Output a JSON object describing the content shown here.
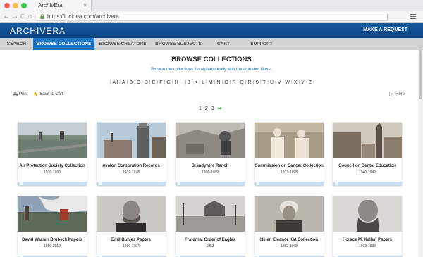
{
  "browser": {
    "tab_title": "ArchivEra",
    "tab_close": "×",
    "back": "←",
    "forward": "→",
    "reload": "C",
    "home": "⌂",
    "url": "https://lucidea.com/archivera",
    "traffic_colors": [
      "#fc605b",
      "#fdbc40",
      "#34c84a"
    ]
  },
  "header": {
    "logo": "ARCHIVERA",
    "request": "MAKE A REQUEST"
  },
  "nav": [
    {
      "label": "SEARCH",
      "active": false
    },
    {
      "label": "BROWSE COLLECTIONS",
      "active": true
    },
    {
      "label": "BROWSE CREATORS",
      "active": false
    },
    {
      "label": "BROWSE SUBJECTS",
      "active": false
    },
    {
      "label": "CART",
      "active": false
    },
    {
      "label": "SUPPORT",
      "active": false
    }
  ],
  "main": {
    "title": "BROWSE COLLECTIONS",
    "subtitle": "Browse the collections list alphabetically with the alphabet filters.",
    "alphabet": [
      "All",
      "A",
      "B",
      "C",
      "D",
      "E",
      "F",
      "G",
      "H",
      "I",
      "J",
      "K",
      "L",
      "M",
      "N",
      "O",
      "P",
      "Q",
      "R",
      "S",
      "T",
      "U",
      "V",
      "W",
      "X",
      "Y",
      "Z"
    ],
    "actions": {
      "print": "Print",
      "save": "Save to Cart",
      "more": "More"
    },
    "pager": {
      "p1": "1",
      "p2": "2",
      "p3": "3",
      "next": "➡"
    }
  },
  "cards": [
    {
      "title": "Air Protection Society Collection",
      "dates": "1979-1990"
    },
    {
      "title": "Avalon Corporation Records",
      "dates": "1939-1978"
    },
    {
      "title": "Brandywire Ranch",
      "dates": "1901-1989"
    },
    {
      "title": "Commission on Cancer Collection",
      "dates": "1913-1998"
    },
    {
      "title": "Council on Dental Education",
      "dates": "1940-1949"
    },
    {
      "title": "David Warren Brubeck Papers",
      "dates": "1950-2012"
    },
    {
      "title": "Emil Bunjes Papers",
      "dates": "1890-1934"
    },
    {
      "title": "Fraternal Order of Eagles",
      "dates": "1953"
    },
    {
      "title": "Helen Eleanor Kat Collection",
      "dates": "1882-1968"
    },
    {
      "title": "Horace M. Kallen Papers",
      "dates": "1913-1998"
    }
  ],
  "colors": {
    "brand": "#0e4d8c",
    "nav_active": "#1d77c4",
    "link": "#1d6fb8",
    "card_footer": "#c9dced"
  }
}
